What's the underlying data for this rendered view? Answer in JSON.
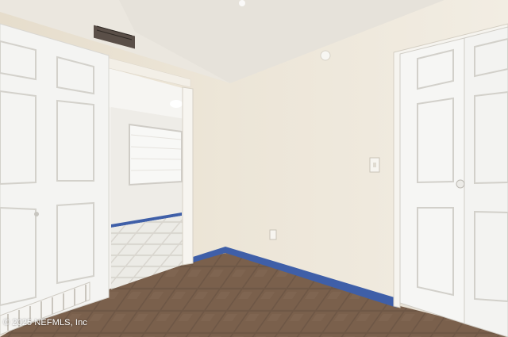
{
  "photo": {
    "watermark": "© 2025 NEFMLS, Inc",
    "colors": {
      "wall": "#efe9dd",
      "ceiling": "#ece8e0",
      "baseboard": "#3f5fa8",
      "floor_tile": "#6e5746",
      "door": "#f4f4f2",
      "next_room_floor": "#e9e7e2"
    }
  }
}
